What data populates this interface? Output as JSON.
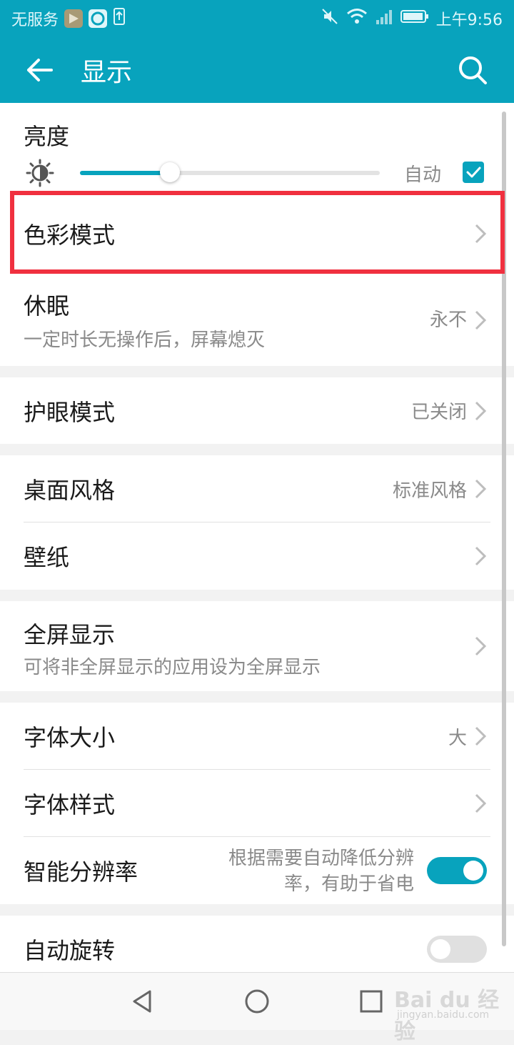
{
  "statusbar": {
    "carrier": "无服务",
    "time": "上午9:56"
  },
  "appbar": {
    "title": "显示"
  },
  "brightness": {
    "label": "亮度",
    "level": 0.3,
    "auto_label": "自动",
    "auto_checked": true
  },
  "items": {
    "color_mode": {
      "label": "色彩模式"
    },
    "sleep": {
      "label": "休眠",
      "sub": "一定时长无操作后，屏幕熄灭",
      "value": "永不"
    },
    "eye_care": {
      "label": "护眼模式",
      "value": "已关闭"
    },
    "home_style": {
      "label": "桌面风格",
      "value": "标准风格"
    },
    "wallpaper": {
      "label": "壁纸"
    },
    "fullscreen": {
      "label": "全屏显示",
      "sub": "可将非全屏显示的应用设为全屏显示"
    },
    "font_size": {
      "label": "字体大小",
      "value": "大"
    },
    "font_style": {
      "label": "字体样式"
    },
    "smart_res": {
      "label": "智能分辨率",
      "desc_line1": "根据需要自动降低分辨",
      "desc_line2": "率，有助于省电",
      "enabled": true
    },
    "auto_rotate": {
      "label": "自动旋转",
      "enabled": false
    }
  },
  "watermark": {
    "brand": "Bai du 经验",
    "url": "jingyan.baidu.com"
  },
  "colors": {
    "accent": "#08a3bd",
    "highlight": "#f0303f"
  }
}
